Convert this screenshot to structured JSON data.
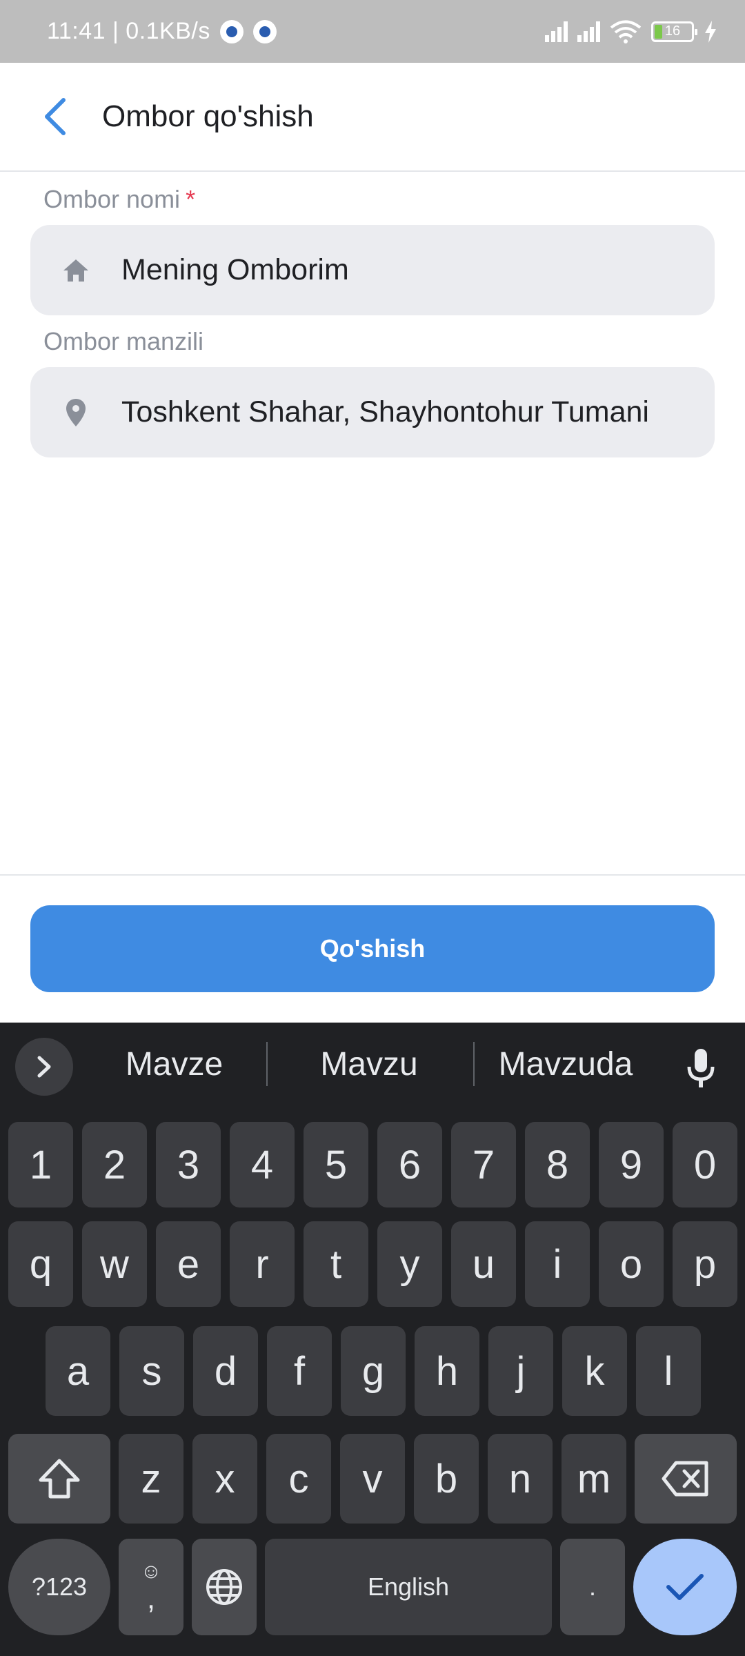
{
  "status_bar": {
    "time_speed": "11:41 | 0.1KB/s",
    "battery": "16"
  },
  "app_bar": {
    "title": "Ombor qo'shish",
    "back_icon": "chevron-left-icon"
  },
  "form": {
    "name_label": "Ombor nomi",
    "name_required_mark": "*",
    "name_value": "Mening Omborim",
    "name_icon": "home-icon",
    "address_label": "Ombor manzili",
    "address_value": "Toshkent Shahar, Shayhontohur Tumani",
    "address_icon": "location-pin-icon"
  },
  "submit_label": "Qo'shish",
  "colors": {
    "accent": "#3f8be2",
    "required": "#e53950",
    "keyboard_bg": "#202124",
    "enter_key": "#a8c7fa"
  },
  "keyboard": {
    "suggestions": [
      "Mavze",
      "Mavzu",
      "Mavzuda"
    ],
    "number_row": [
      "1",
      "2",
      "3",
      "4",
      "5",
      "6",
      "7",
      "8",
      "9",
      "0"
    ],
    "row1": [
      "q",
      "w",
      "e",
      "r",
      "t",
      "y",
      "u",
      "i",
      "o",
      "p"
    ],
    "row2": [
      "a",
      "s",
      "d",
      "f",
      "g",
      "h",
      "j",
      "k",
      "l"
    ],
    "row3": [
      "z",
      "x",
      "c",
      "v",
      "b",
      "n",
      "m"
    ],
    "symbols_label": "?123",
    "comma_label": ",",
    "space_label": "English",
    "period_label": "."
  }
}
